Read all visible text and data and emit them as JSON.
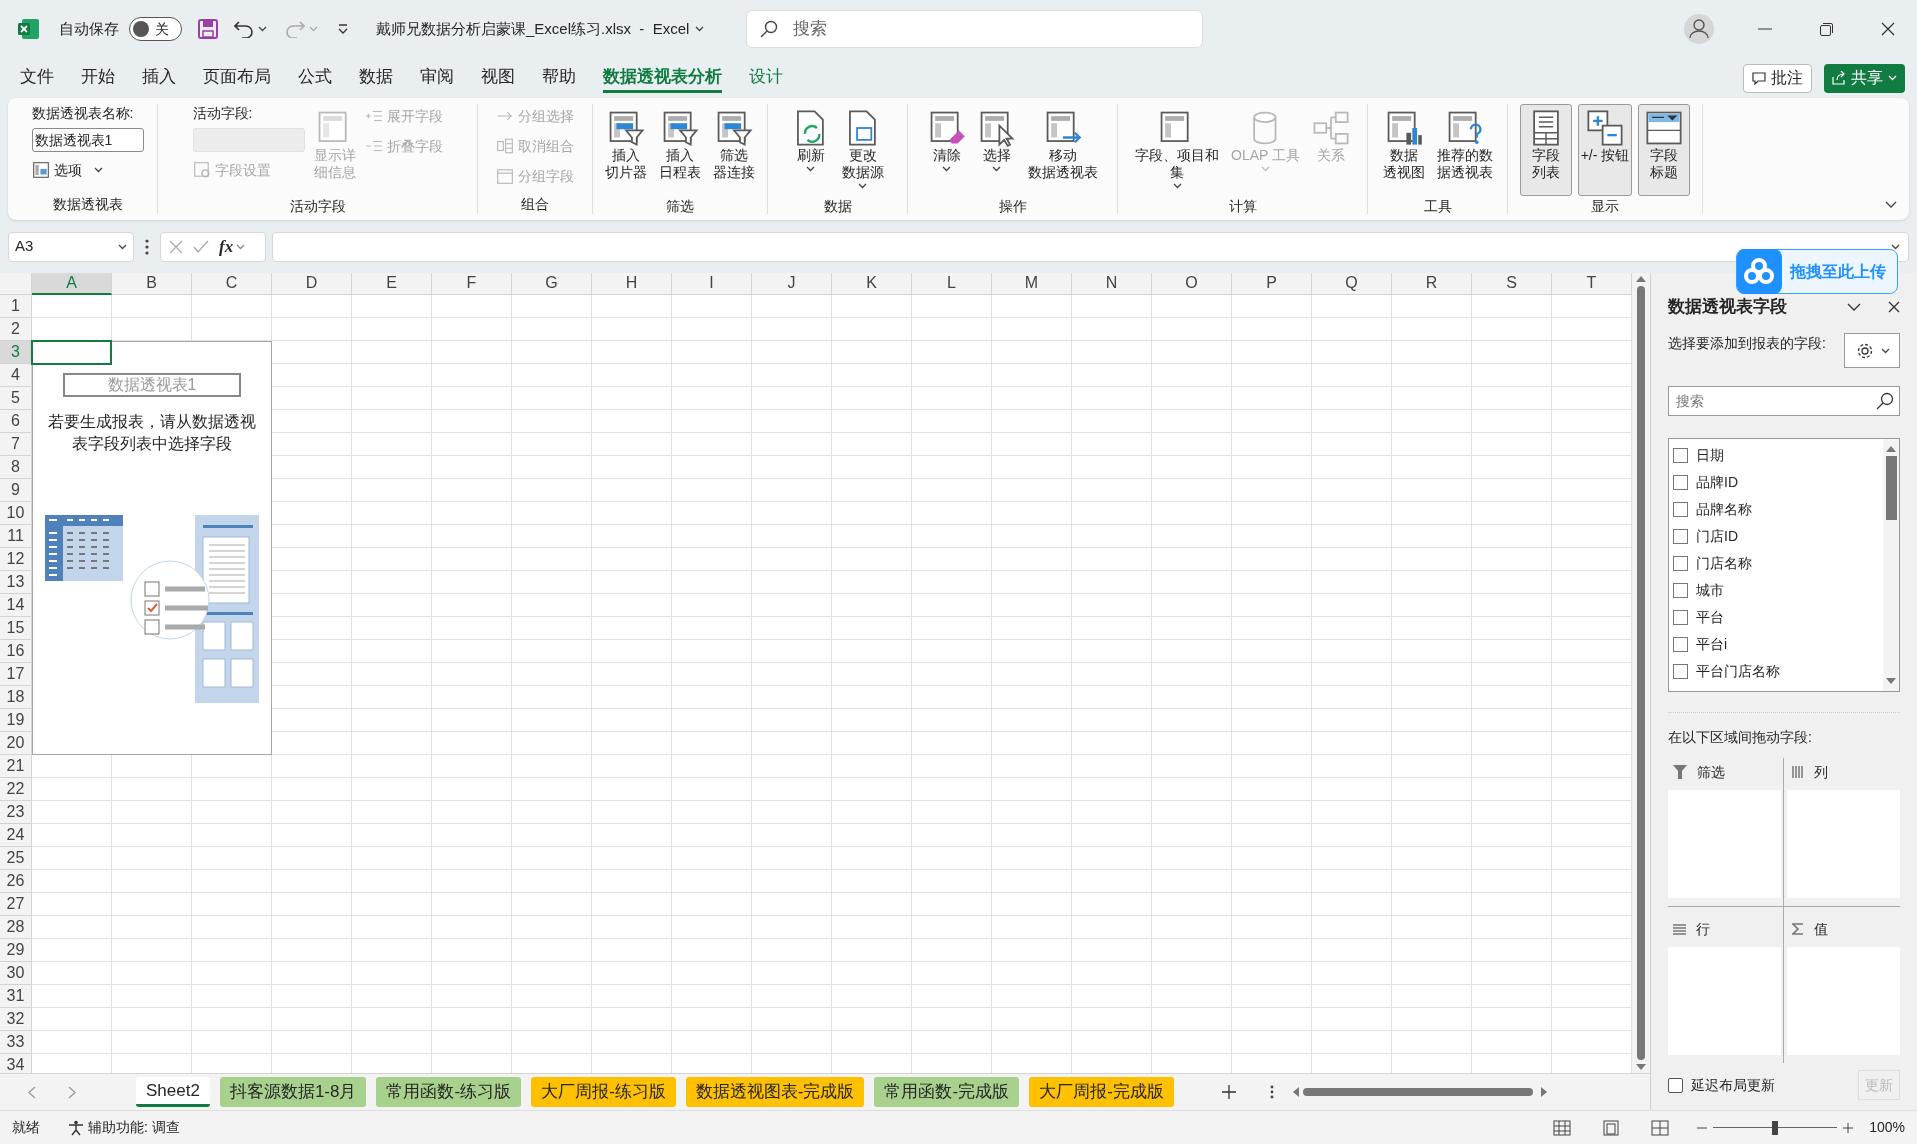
{
  "title_bar": {
    "autosave_label": "自动保存",
    "autosave": {
      "on": false,
      "label": "关"
    },
    "document_title": "戴师兄数据分析启蒙课_Excel练习.xlsx  -  Excel",
    "search_placeholder": "搜索"
  },
  "menu_tabs": [
    {
      "label": "文件",
      "selected": false,
      "contextual": false
    },
    {
      "label": "开始",
      "selected": false,
      "contextual": false
    },
    {
      "label": "插入",
      "selected": false,
      "contextual": false
    },
    {
      "label": "页面布局",
      "selected": false,
      "contextual": false
    },
    {
      "label": "公式",
      "selected": false,
      "contextual": false
    },
    {
      "label": "数据",
      "selected": false,
      "contextual": false
    },
    {
      "label": "审阅",
      "selected": false,
      "contextual": false
    },
    {
      "label": "视图",
      "selected": false,
      "contextual": false
    },
    {
      "label": "帮助",
      "selected": false,
      "contextual": false
    },
    {
      "label": "数据透视表分析",
      "selected": true,
      "contextual": true
    },
    {
      "label": "设计",
      "selected": false,
      "contextual": true
    }
  ],
  "comment_button": "批注",
  "share_button": "共享",
  "ribbon": {
    "groups": [
      {
        "label": "数据透视表",
        "columns": [
          [
            {
              "kind": "label",
              "label": "数据透视表名称:"
            },
            {
              "kind": "field",
              "value": "数据透视表1"
            },
            {
              "kind": "small",
              "label": "选项",
              "dropdown": true,
              "disabled": false
            }
          ]
        ]
      },
      {
        "label": "活动字段",
        "columns": [
          [
            {
              "kind": "label",
              "label": "活动字段:"
            },
            {
              "kind": "field",
              "disabled": true
            },
            {
              "kind": "small",
              "label": "字段设置",
              "dropdown": false,
              "disabled": true
            }
          ],
          [
            {
              "kind": "large",
              "lines": [
                "显示详",
                "细信息"
              ],
              "dropdown": false,
              "disabled": true
            }
          ],
          [
            {
              "kind": "small",
              "label": "展开字段",
              "dropdown": false,
              "disabled": true
            },
            {
              "kind": "small",
              "label": "折叠字段",
              "dropdown": false,
              "disabled": true
            }
          ]
        ]
      },
      {
        "label": "组合",
        "columns": [
          [
            {
              "kind": "small",
              "label": "分组选择",
              "dropdown": false,
              "disabled": true
            },
            {
              "kind": "small",
              "label": "取消组合",
              "dropdown": false,
              "disabled": true
            },
            {
              "kind": "small",
              "label": "分组字段",
              "dropdown": false,
              "disabled": true
            }
          ]
        ]
      },
      {
        "label": "筛选",
        "columns": [
          [
            {
              "kind": "large",
              "lines": [
                "插入",
                "切片器"
              ],
              "dropdown": false,
              "disabled": false
            }
          ],
          [
            {
              "kind": "large",
              "lines": [
                "插入",
                "日程表"
              ],
              "dropdown": false,
              "disabled": false
            }
          ],
          [
            {
              "kind": "large",
              "lines": [
                "筛选",
                "器连接"
              ],
              "dropdown": false,
              "disabled": false
            }
          ]
        ]
      },
      {
        "label": "数据",
        "columns": [
          [
            {
              "kind": "large",
              "lines": [
                "刷新"
              ],
              "dropdown": true,
              "disabled": false
            }
          ],
          [
            {
              "kind": "large",
              "lines": [
                "更改",
                "数据源"
              ],
              "dropdown": true,
              "disabled": false
            }
          ]
        ]
      },
      {
        "label": "操作",
        "columns": [
          [
            {
              "kind": "large",
              "lines": [
                "清除"
              ],
              "dropdown": true,
              "disabled": false
            }
          ],
          [
            {
              "kind": "large",
              "lines": [
                "选择"
              ],
              "dropdown": true,
              "disabled": false
            }
          ],
          [
            {
              "kind": "large",
              "lines": [
                "移动",
                "数据透视表"
              ],
              "dropdown": false,
              "disabled": false
            }
          ]
        ]
      },
      {
        "label": "计算",
        "columns": [
          [
            {
              "kind": "large",
              "lines": [
                "字段、项目和",
                "集"
              ],
              "dropdown": true,
              "disabled": false
            }
          ],
          [
            {
              "kind": "large",
              "lines": [
                "OLAP 工具"
              ],
              "dropdown": true,
              "disabled": true
            }
          ],
          [
            {
              "kind": "large",
              "lines": [
                "关系"
              ],
              "dropdown": false,
              "disabled": true
            }
          ]
        ]
      },
      {
        "label": "工具",
        "columns": [
          [
            {
              "kind": "large",
              "lines": [
                "数据",
                "透视图"
              ],
              "dropdown": false,
              "disabled": false
            }
          ],
          [
            {
              "kind": "large",
              "lines": [
                "推荐的数",
                "据透视表"
              ],
              "dropdown": false,
              "disabled": false
            }
          ]
        ]
      },
      {
        "label": "显示",
        "columns": [
          [
            {
              "kind": "large",
              "lines": [
                "字段",
                "列表"
              ],
              "dropdown": false,
              "disabled": false,
              "pressed": true
            }
          ],
          [
            {
              "kind": "large",
              "lines": [
                "+/- 按钮"
              ],
              "dropdown": false,
              "disabled": false,
              "pressed": true
            }
          ],
          [
            {
              "kind": "large",
              "lines": [
                "字段",
                "标题"
              ],
              "dropdown": false,
              "disabled": false,
              "pressed": true
            }
          ]
        ]
      }
    ]
  },
  "formula_bar": {
    "name_box": "A3",
    "function_label": "fx"
  },
  "sheet": {
    "columns": [
      {
        "label": "A",
        "selected": true
      },
      {
        "label": "B",
        "selected": false
      },
      {
        "label": "C",
        "selected": false
      },
      {
        "label": "D",
        "selected": false
      },
      {
        "label": "E",
        "selected": false
      },
      {
        "label": "F",
        "selected": false
      },
      {
        "label": "G",
        "selected": false
      },
      {
        "label": "H",
        "selected": false
      },
      {
        "label": "I",
        "selected": false
      },
      {
        "label": "J",
        "selected": false
      },
      {
        "label": "K",
        "selected": false
      },
      {
        "label": "L",
        "selected": false
      },
      {
        "label": "M",
        "selected": false
      },
      {
        "label": "N",
        "selected": false
      },
      {
        "label": "O",
        "selected": false
      },
      {
        "label": "P",
        "selected": false
      },
      {
        "label": "Q",
        "selected": false
      },
      {
        "label": "R",
        "selected": false
      },
      {
        "label": "S",
        "selected": false
      },
      {
        "label": "T",
        "selected": false
      }
    ],
    "rows": [
      {
        "label": "1",
        "selected": false
      },
      {
        "label": "2",
        "selected": false
      },
      {
        "label": "3",
        "selected": true
      },
      {
        "label": "4",
        "selected": false
      },
      {
        "label": "5",
        "selected": false
      },
      {
        "label": "6",
        "selected": false
      },
      {
        "label": "7",
        "selected": false
      },
      {
        "label": "8",
        "selected": false
      },
      {
        "label": "9",
        "selected": false
      },
      {
        "label": "10",
        "selected": false
      },
      {
        "label": "11",
        "selected": false
      },
      {
        "label": "12",
        "selected": false
      },
      {
        "label": "13",
        "selected": false
      },
      {
        "label": "14",
        "selected": false
      },
      {
        "label": "15",
        "selected": false
      },
      {
        "label": "16",
        "selected": false
      },
      {
        "label": "17",
        "selected": false
      },
      {
        "label": "18",
        "selected": false
      },
      {
        "label": "19",
        "selected": false
      },
      {
        "label": "20",
        "selected": false
      },
      {
        "label": "21",
        "selected": false
      },
      {
        "label": "22",
        "selected": false
      },
      {
        "label": "23",
        "selected": false
      },
      {
        "label": "24",
        "selected": false
      },
      {
        "label": "25",
        "selected": false
      },
      {
        "label": "26",
        "selected": false
      },
      {
        "label": "27",
        "selected": false
      },
      {
        "label": "28",
        "selected": false
      },
      {
        "label": "29",
        "selected": false
      },
      {
        "label": "30",
        "selected": false
      },
      {
        "label": "31",
        "selected": false
      },
      {
        "label": "32",
        "selected": false
      },
      {
        "label": "33",
        "selected": false
      },
      {
        "label": "34",
        "selected": false
      }
    ],
    "pivot_placeholder": {
      "title": "数据透视表1",
      "message": "若要生成报表，请从数据透视表字段列表中选择字段"
    }
  },
  "sheet_tabs": [
    {
      "label": "Sheet2",
      "selected": true
    },
    {
      "label": "抖客源数据1-8月",
      "selected": false,
      "color": "#a9d18e"
    },
    {
      "label": "常用函数-练习版",
      "selected": false,
      "color": "#a9d18e"
    },
    {
      "label": "大厂周报-练习版",
      "selected": false,
      "color": "#ffc000"
    },
    {
      "label": "数据透视图表-完成版",
      "selected": false,
      "color": "#ffc000"
    },
    {
      "label": "常用函数-完成版",
      "selected": false,
      "color": "#a9d18e"
    },
    {
      "label": "大厂周报-完成版",
      "selected": false,
      "color": "#ffc000"
    }
  ],
  "status_bar": {
    "ready": "就绪",
    "accessibility": "辅助功能: 调查",
    "zoom": {
      "level": 0.5,
      "label": "100%"
    }
  },
  "field_pane": {
    "upload_badge": "拖拽至此上传",
    "title": "数据透视表字段",
    "prompt": "选择要添加到报表的字段:",
    "search_placeholder": "搜索",
    "fields": [
      {
        "label": "日期",
        "checked": false
      },
      {
        "label": "品牌ID",
        "checked": false
      },
      {
        "label": "品牌名称",
        "checked": false
      },
      {
        "label": "门店ID",
        "checked": false
      },
      {
        "label": "门店名称",
        "checked": false
      },
      {
        "label": "城市",
        "checked": false
      },
      {
        "label": "平台",
        "checked": false
      },
      {
        "label": "平台i",
        "checked": false
      },
      {
        "label": "平台门店名称",
        "checked": false
      }
    ],
    "areas_label": "在以下区域间拖动字段:",
    "areas": [
      {
        "label": "筛选",
        "kind": "filter"
      },
      {
        "label": "列",
        "kind": "columns"
      },
      {
        "label": "行",
        "kind": "rows"
      },
      {
        "label": "值",
        "kind": "values"
      }
    ],
    "defer_update": {
      "label": "延迟布局更新",
      "checked": false
    },
    "update_button": {
      "label": "更新",
      "disabled": true
    }
  }
}
